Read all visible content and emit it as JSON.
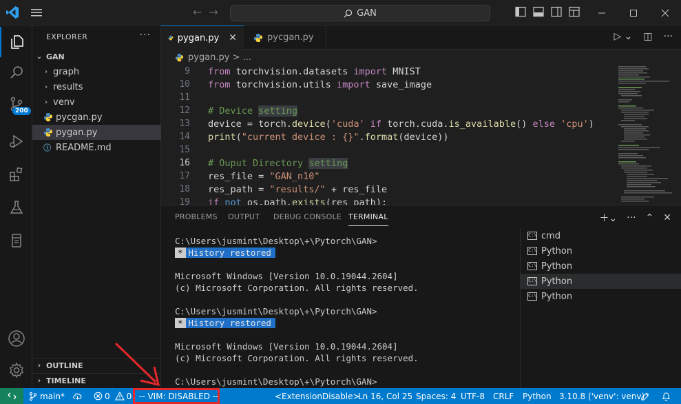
{
  "titlebar": {
    "search_text": "GAN",
    "nav_back": "←",
    "nav_forward": "→"
  },
  "activitybar": {
    "scm_badge": "200"
  },
  "sidebar": {
    "title": "EXPLORER",
    "more": "···",
    "root": "GAN",
    "items": [
      {
        "label": "graph",
        "type": "folder"
      },
      {
        "label": "results",
        "type": "folder"
      },
      {
        "label": "venv",
        "type": "folder"
      },
      {
        "label": "pycgan.py",
        "type": "python"
      },
      {
        "label": "pygan.py",
        "type": "python",
        "selected": true
      },
      {
        "label": "README.md",
        "type": "markdown"
      }
    ],
    "outline": "OUTLINE",
    "timeline": "TIMELINE"
  },
  "tabs": [
    {
      "label": "pygan.py",
      "active": true
    },
    {
      "label": "pycgan.py",
      "active": false
    }
  ],
  "breadcrumb": "pygan.py > ...",
  "code_lines": [
    {
      "n": "9",
      "tokens": [
        [
          "kw",
          "from"
        ],
        [
          "dflt",
          " torchvision.datasets "
        ],
        [
          "kw",
          "import"
        ],
        [
          "dflt",
          " MNIST"
        ]
      ]
    },
    {
      "n": "10",
      "tokens": [
        [
          "kw",
          "from"
        ],
        [
          "dflt",
          " torchvision.utils "
        ],
        [
          "kw",
          "import"
        ],
        [
          "dflt",
          " save_image"
        ]
      ]
    },
    {
      "n": "11",
      "tokens": []
    },
    {
      "n": "12",
      "tokens": [
        [
          "cm",
          "# Device "
        ],
        [
          "cmhl",
          "setting"
        ]
      ]
    },
    {
      "n": "13",
      "tokens": [
        [
          "dflt",
          "device = torch."
        ],
        [
          "fn",
          "device"
        ],
        [
          "dflt",
          "("
        ],
        [
          "str",
          "'cuda'"
        ],
        [
          "kw",
          " if "
        ],
        [
          "dflt",
          "torch.cuda."
        ],
        [
          "fn",
          "is_available"
        ],
        [
          "dflt",
          "() "
        ],
        [
          "kw",
          "else"
        ],
        [
          "str",
          " 'cpu'"
        ],
        [
          "dflt",
          ")"
        ]
      ]
    },
    {
      "n": "14",
      "tokens": [
        [
          "fn",
          "print"
        ],
        [
          "dflt",
          "("
        ],
        [
          "str",
          "\"current device : {}\""
        ],
        [
          "dflt",
          "."
        ],
        [
          "fn",
          "format"
        ],
        [
          "dflt",
          "(device))"
        ]
      ]
    },
    {
      "n": "15",
      "tokens": []
    },
    {
      "n": "16",
      "tokens": [
        [
          "cm",
          "# Ouput Directory "
        ],
        [
          "cmhl",
          "setting"
        ]
      ],
      "current": true
    },
    {
      "n": "17",
      "tokens": [
        [
          "dflt",
          "res_file = "
        ],
        [
          "str",
          "\"GAN_n10\""
        ]
      ]
    },
    {
      "n": "18",
      "tokens": [
        [
          "dflt",
          "res_path = "
        ],
        [
          "str",
          "\"results/\""
        ],
        [
          "dflt",
          " + res_file"
        ]
      ]
    },
    {
      "n": "19",
      "tokens": [
        [
          "kw",
          "if"
        ],
        [
          "kwb",
          " not"
        ],
        [
          "dflt",
          " os.path."
        ],
        [
          "fn",
          "exists"
        ],
        [
          "dflt",
          "(res_path):"
        ]
      ]
    }
  ],
  "panel": {
    "tabs": [
      "PROBLEMS",
      "OUTPUT",
      "DEBUG CONSOLE",
      "TERMINAL"
    ],
    "active_tab": "TERMINAL",
    "terminal_lines": [
      {
        "text": "C:\\Users\\jusmint\\Desktop\\+\\Pytorch\\GAN>"
      },
      {
        "history": "History restored"
      },
      {
        "text": ""
      },
      {
        "text": "Microsoft Windows [Version 10.0.19044.2604]"
      },
      {
        "text": "(c) Microsoft Corporation. All rights reserved."
      },
      {
        "text": ""
      },
      {
        "text": "C:\\Users\\jusmint\\Desktop\\+\\Pytorch\\GAN>"
      },
      {
        "history": "History restored"
      },
      {
        "text": ""
      },
      {
        "text": "Microsoft Windows [Version 10.0.19044.2604]"
      },
      {
        "text": "(c) Microsoft Corporation. All rights reserved."
      },
      {
        "text": ""
      },
      {
        "text": "C:\\Users\\jusmint\\Desktop\\+\\Pytorch\\GAN>"
      }
    ],
    "terminals": [
      {
        "label": "cmd"
      },
      {
        "label": "Python"
      },
      {
        "label": "Python"
      },
      {
        "label": "Python",
        "selected": true
      },
      {
        "label": "Python"
      }
    ]
  },
  "statusbar": {
    "branch": "main*",
    "errors": "0",
    "warnings": "0",
    "vim": "-- VIM: DISABLED --",
    "extension": "<ExtensionDisable>",
    "position": "Ln 16, Col 25",
    "spaces": "Spaces: 4",
    "encoding": "UTF-8",
    "eol": "CRLF",
    "language": "Python",
    "interpreter": "3.10.8 ('venv': venv)"
  },
  "colors": {
    "accent": "#0078d4",
    "statusbar": "#007acc",
    "highlight_box": "#e8272b"
  }
}
